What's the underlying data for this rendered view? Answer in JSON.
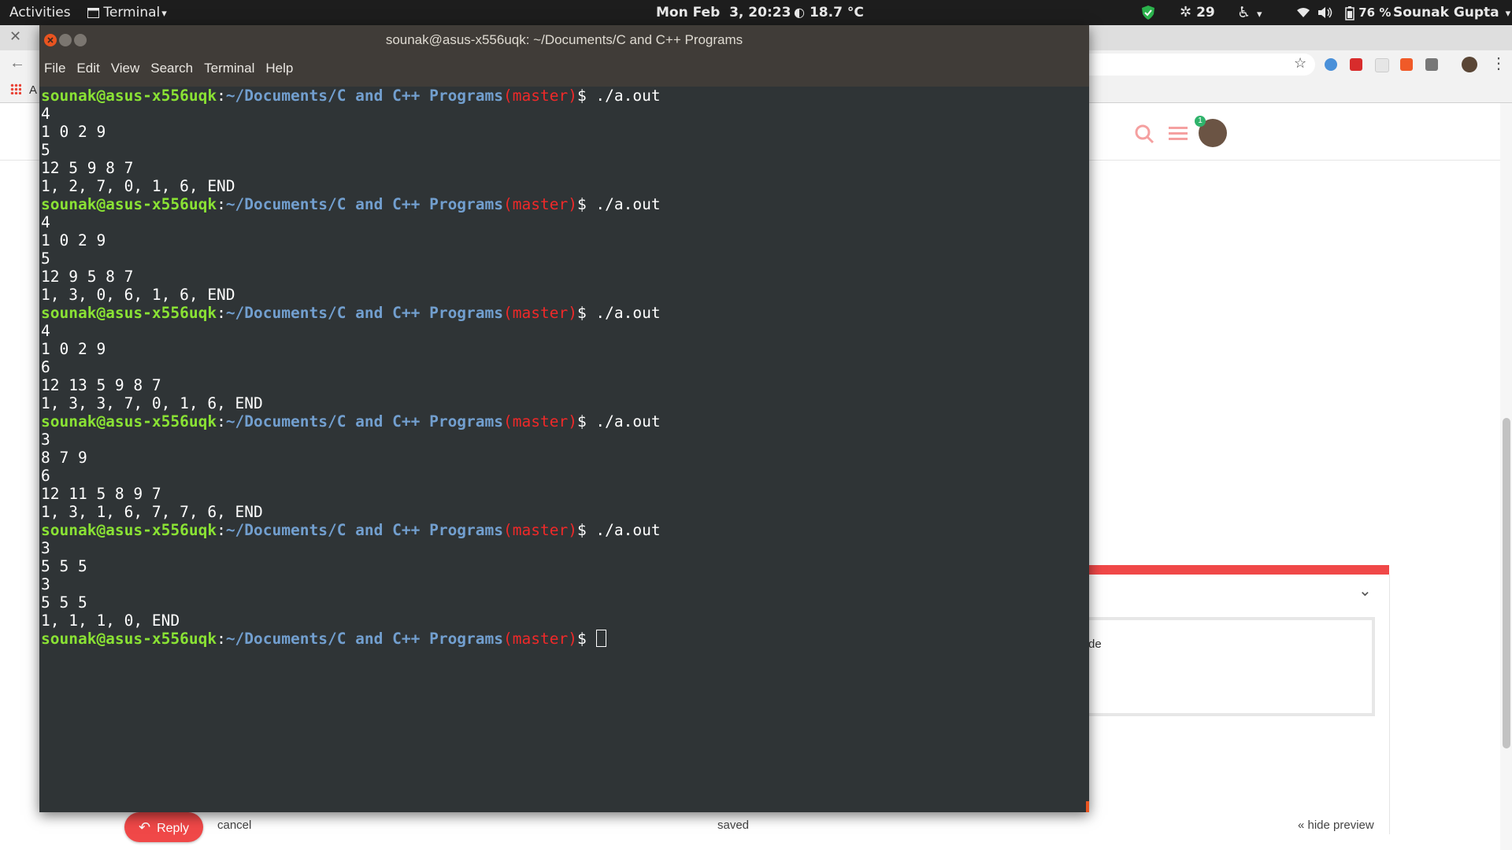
{
  "topbar": {
    "activities": "Activities",
    "app_menu": "Terminal",
    "app_menu_arrow": "▾",
    "clock": "Mon Feb  3, 20:23",
    "weather_temp": "18.7 °C",
    "notifications_count": "29",
    "battery": "76 %",
    "user": "Sounak Gupta",
    "arrow": "▾"
  },
  "terminal": {
    "title": "sounak@asus-x556uqk: ~/Documents/C and C++ Programs",
    "menu": [
      "File",
      "Edit",
      "View",
      "Search",
      "Terminal",
      "Help"
    ],
    "prompt": {
      "user_host": "sounak@asus-x556uqk",
      "colon": ":",
      "path": "~/Documents/C and C++ Programs",
      "branch": "(master)",
      "dollar": "$ "
    },
    "runs": [
      {
        "command": "./a.out",
        "output": [
          "4",
          "1 0 2 9",
          "5",
          "12 5 9 8 7",
          "1, 2, 7, 0, 1, 6, END"
        ]
      },
      {
        "command": "./a.out",
        "output": [
          "4",
          "1 0 2 9",
          "5",
          "12 9 5 8 7",
          "1, 3, 0, 6, 1, 6, END"
        ]
      },
      {
        "command": "./a.out",
        "output": [
          "4",
          "1 0 2 9",
          "6",
          "12 13 5 9 8 7",
          "1, 3, 3, 7, 0, 1, 6, END"
        ]
      },
      {
        "command": "./a.out",
        "output": [
          "3",
          "8 7 9",
          "6",
          "12 11 5 8 9 7",
          "1, 3, 1, 6, 7, 7, 6, END"
        ]
      },
      {
        "command": "./a.out",
        "output": [
          "3",
          "5 5 5",
          "3",
          "5 5 5",
          "1, 1, 1, 0, END"
        ]
      }
    ]
  },
  "browser": {
    "bookmarks_partial": "A",
    "panel_text_partial": "de",
    "reply_label": "Reply",
    "cancel_label": "cancel",
    "status_label": "saved",
    "hide_preview_label": "« hide preview",
    "notification_badge": "1"
  },
  "colors": {
    "topbar_bg": "#1d1d1d",
    "terminal_bg": "#2f3436",
    "prompt_user": "#8ae234",
    "prompt_path": "#729fcf",
    "prompt_branch": "#ef2929",
    "accent_red": "#f04848"
  }
}
